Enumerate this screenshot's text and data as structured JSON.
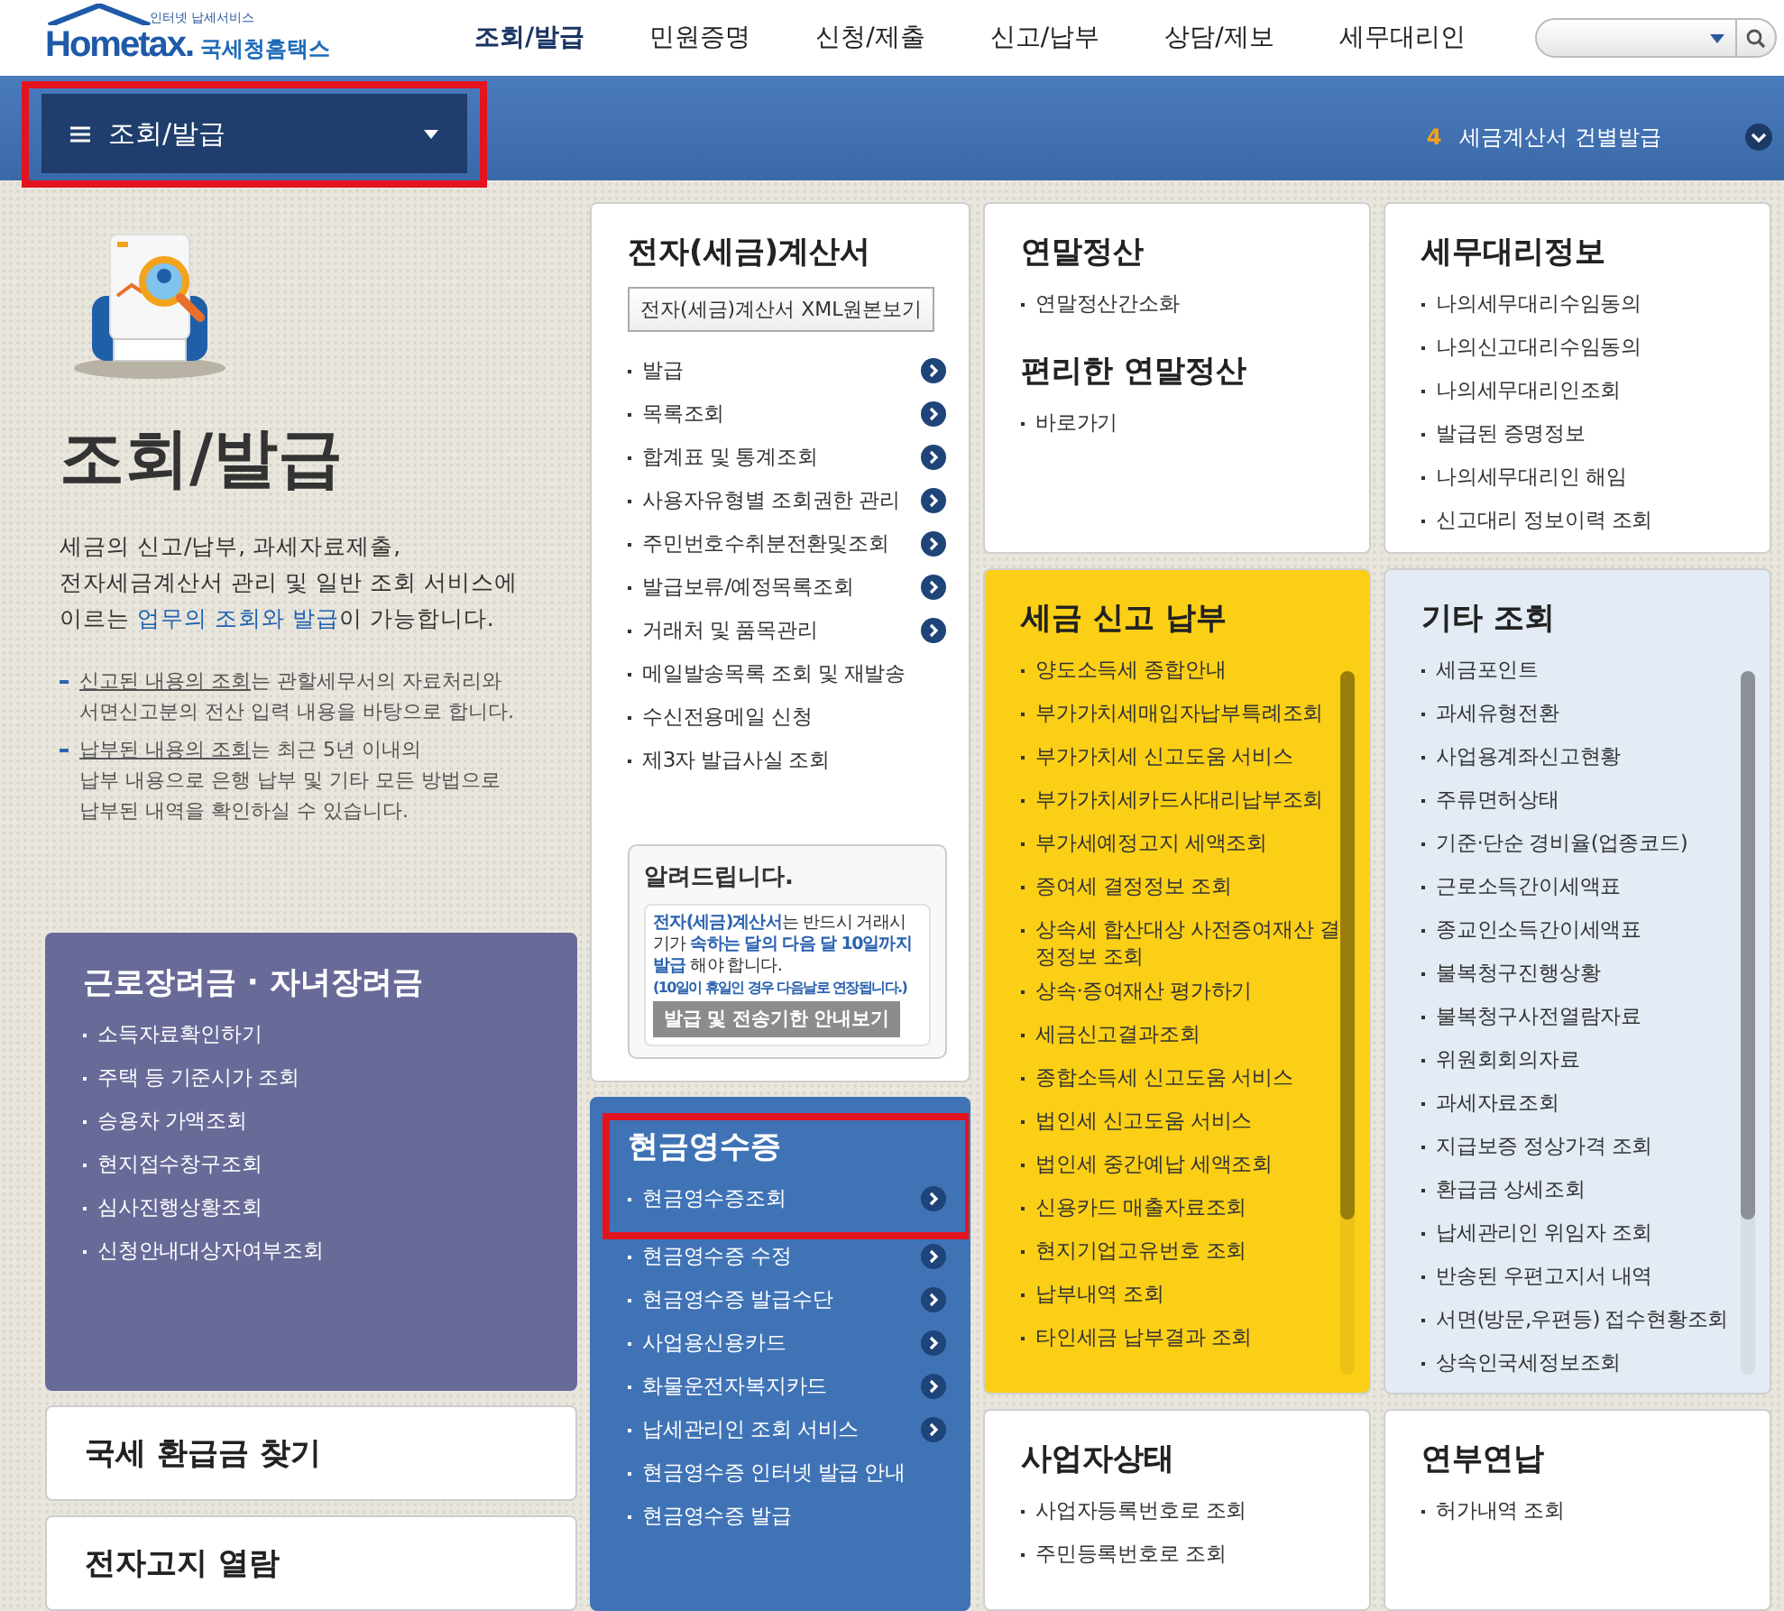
{
  "header": {
    "logo": {
      "tagline": "인터넷 납세서비스",
      "wordmark": "Hometax.",
      "name": "국세청홈택스"
    },
    "nav": [
      {
        "label": "조회/발급",
        "selected": true
      },
      {
        "label": "민원증명",
        "selected": false
      },
      {
        "label": "신청/제출",
        "selected": false
      },
      {
        "label": "신고/납부",
        "selected": false
      },
      {
        "label": "상담/제보",
        "selected": false
      },
      {
        "label": "세무대리인",
        "selected": false
      }
    ]
  },
  "subbar": {
    "menu": {
      "label": "조회/발급",
      "highlighted": true
    },
    "notice": {
      "number": "4",
      "text": "세금계산서 건별발급"
    }
  },
  "columns": [
    {
      "sections": [
        {
          "kind": "intro",
          "title": "조회/발급",
          "description": "세금의 신고/납부, 과세자료제출,\n전자세금계산서 관리 및 일반 조회 서비스에\n이르는 **업무의 조회와 발급**이 가능합니다.",
          "notes": [
            "**신고된 내용의 조회**는 관할세무서의 자료처리와\n서면신고분의 전산 입력 내용을 바탕으로 합니다.",
            "**납부된 내용의 조회**는 최근 5년 이내의\n납부 내용으로 은행 납부 및 기타 모든 방법으로\n납부된 내역을 확인하실 수 있습니다."
          ]
        },
        {
          "kind": "card",
          "color": "#686a98",
          "title": "근로장려금 · 자녀장려금",
          "items": [
            {
              "label": "소득자료확인하기",
              "arrow": false
            },
            {
              "label": "주택 등 기준시가 조회",
              "arrow": false
            },
            {
              "label": "승용차 가액조회",
              "arrow": false
            },
            {
              "label": "현지접수창구조회",
              "arrow": false
            },
            {
              "label": "심사진행상황조회",
              "arrow": false
            },
            {
              "label": "신청안내대상자여부조회",
              "arrow": false
            }
          ]
        },
        {
          "kind": "link_card",
          "title": "국세 환급금 찾기"
        },
        {
          "kind": "link_card",
          "title": "전자고지 열람"
        }
      ]
    },
    {
      "sections": [
        {
          "kind": "card",
          "color": "#ffffff",
          "title": "전자(세금)계산서",
          "button": "전자(세금)계산서 XML원본보기",
          "items": [
            {
              "label": "발급",
              "arrow": true
            },
            {
              "label": "목록조회",
              "arrow": true
            },
            {
              "label": "합계표 및 통계조회",
              "arrow": true
            },
            {
              "label": "사용자유형별 조회권한 관리",
              "arrow": true
            },
            {
              "label": "주민번호수취분전환및조회",
              "arrow": true
            },
            {
              "label": "발급보류/예정목록조회",
              "arrow": true
            },
            {
              "label": "거래처 및 품목관리",
              "arrow": true
            },
            {
              "label": "메일발송목록 조회 및 재발송",
              "arrow": false
            },
            {
              "label": "수신전용메일 신청",
              "arrow": false
            },
            {
              "label": "제3자 발급사실 조회",
              "arrow": false
            }
          ],
          "notice": {
            "title": "알려드립니다.",
            "text": "**전자(세금)계산서**는 반드시 거래시기가 **속하는 달의 다음 달 10일까지 발급** 해야 합니다.",
            "note": "(10일이 휴일인 경우 다음날로 연장됩니다.)",
            "button": "발급 및 전송기한 안내보기"
          }
        },
        {
          "kind": "card",
          "color": "#3f73b6",
          "title": "현금영수증",
          "highlighted": true,
          "items": [
            {
              "label": "현금영수증조회",
              "arrow": true
            },
            {
              "label": "현금영수증 수정",
              "arrow": true
            },
            {
              "label": "현금영수증 발급수단",
              "arrow": true
            },
            {
              "label": "사업용신용카드",
              "arrow": true
            },
            {
              "label": "화물운전자복지카드",
              "arrow": true
            },
            {
              "label": "납세관리인 조회 서비스",
              "arrow": true
            },
            {
              "label": "현금영수증 인터넷 발급 안내",
              "arrow": false
            },
            {
              "label": "현금영수증 발급",
              "arrow": false
            }
          ]
        }
      ]
    },
    {
      "sections": [
        {
          "kind": "card",
          "color": "#ffffff",
          "title": "연말정산",
          "items": [
            {
              "label": "연말정산간소화",
              "arrow": false
            }
          ],
          "subtitle": "편리한 연말정산",
          "subitems": [
            {
              "label": "바로가기",
              "arrow": false
            }
          ]
        },
        {
          "kind": "card",
          "color": "#fbcf16",
          "title": "세금 신고 납부",
          "scrollable": true,
          "items": [
            {
              "label": "양도소득세 종합안내",
              "arrow": false
            },
            {
              "label": "부가가치세매입자납부특례조회",
              "arrow": false
            },
            {
              "label": "부가가치세 신고도움 서비스",
              "arrow": false
            },
            {
              "label": "부가가치세카드사대리납부조회",
              "arrow": false
            },
            {
              "label": "부가세예정고지 세액조회",
              "arrow": false
            },
            {
              "label": "증여세 결정정보 조회",
              "arrow": false
            },
            {
              "label": "상속세 합산대상 사전증여재산 결정정보 조회",
              "arrow": false
            },
            {
              "label": "상속·증여재산 평가하기",
              "arrow": false
            },
            {
              "label": "세금신고결과조회",
              "arrow": false
            },
            {
              "label": "종합소득세 신고도움 서비스",
              "arrow": false
            },
            {
              "label": "법인세 신고도움 서비스",
              "arrow": false
            },
            {
              "label": "법인세 중간예납 세액조회",
              "arrow": false
            },
            {
              "label": "신용카드 매출자료조회",
              "arrow": false
            },
            {
              "label": "현지기업고유번호 조회",
              "arrow": false
            },
            {
              "label": "납부내역 조회",
              "arrow": false
            },
            {
              "label": "타인세금 납부결과 조회",
              "arrow": false
            }
          ]
        },
        {
          "kind": "card",
          "color": "#ffffff",
          "title": "사업자상태",
          "items": [
            {
              "label": "사업자등록번호로 조회",
              "arrow": false
            },
            {
              "label": "주민등록번호로 조회",
              "arrow": false
            }
          ]
        }
      ]
    },
    {
      "sections": [
        {
          "kind": "card",
          "color": "#ffffff",
          "title": "세무대리정보",
          "items": [
            {
              "label": "나의세무대리수임동의",
              "arrow": false
            },
            {
              "label": "나의신고대리수임동의",
              "arrow": false
            },
            {
              "label": "나의세무대리인조회",
              "arrow": false
            },
            {
              "label": "발급된 증명정보",
              "arrow": false
            },
            {
              "label": "나의세무대리인 해임",
              "arrow": false
            },
            {
              "label": "신고대리 정보이력 조회",
              "arrow": false
            }
          ]
        },
        {
          "kind": "card",
          "color": "#e3ebf4",
          "title": "기타 조회",
          "scrollable": true,
          "items": [
            {
              "label": "세금포인트",
              "arrow": false
            },
            {
              "label": "과세유형전환",
              "arrow": false
            },
            {
              "label": "사업용계좌신고현황",
              "arrow": false
            },
            {
              "label": "주류면허상태",
              "arrow": false
            },
            {
              "label": "기준·단순 경비율(업종코드)",
              "arrow": false
            },
            {
              "label": "근로소득간이세액표",
              "arrow": false
            },
            {
              "label": "종교인소득간이세액표",
              "arrow": false
            },
            {
              "label": "불복청구진행상황",
              "arrow": false
            },
            {
              "label": "불복청구사전열람자료",
              "arrow": false
            },
            {
              "label": "위원회회의자료",
              "arrow": false
            },
            {
              "label": "과세자료조회",
              "arrow": false
            },
            {
              "label": "지급보증 정상가격 조회",
              "arrow": false
            },
            {
              "label": "환급금 상세조회",
              "arrow": false
            },
            {
              "label": "납세관리인 위임자 조회",
              "arrow": false
            },
            {
              "label": "반송된 우편고지서 내역",
              "arrow": false
            },
            {
              "label": "서면(방문,우편등) 접수현황조회",
              "arrow": false
            },
            {
              "label": "상속인국세정보조회",
              "arrow": false
            }
          ]
        },
        {
          "kind": "card",
          "color": "#ffffff",
          "title": "연부연납",
          "items": [
            {
              "label": "허가내역 조회",
              "arrow": false
            }
          ]
        }
      ]
    }
  ]
}
